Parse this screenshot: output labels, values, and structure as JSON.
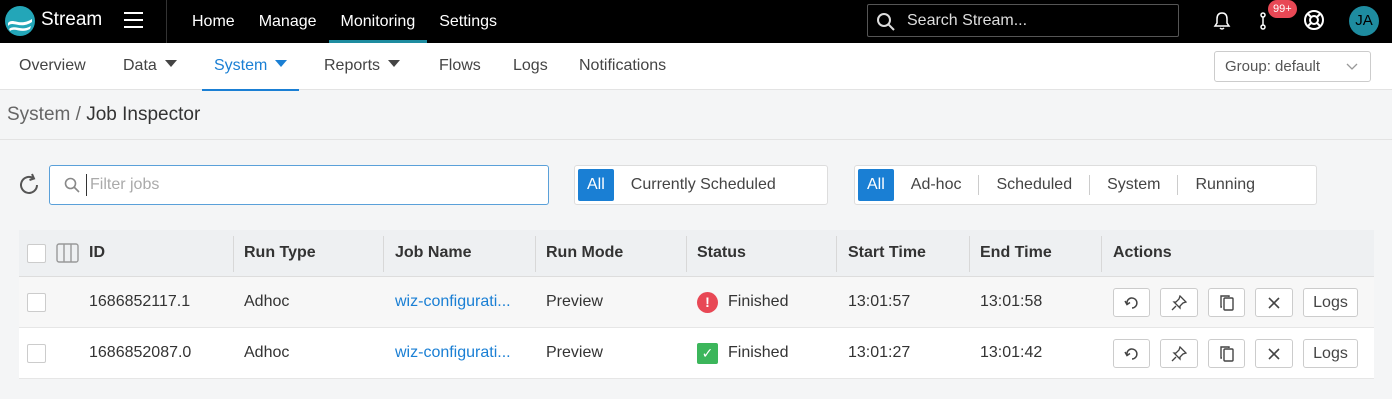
{
  "app": {
    "name": "Stream"
  },
  "topnav": {
    "items": [
      "Home",
      "Manage",
      "Monitoring",
      "Settings"
    ],
    "active": "Monitoring"
  },
  "search": {
    "placeholder": "Search Stream..."
  },
  "notifications": {
    "badge": "99+"
  },
  "user": {
    "initials": "JA"
  },
  "subnav": {
    "overview": "Overview",
    "data": "Data",
    "system": "System",
    "reports": "Reports",
    "flows": "Flows",
    "logs": "Logs",
    "notifications": "Notifications",
    "group": "Group: default"
  },
  "breadcrumb": {
    "parent": "System",
    "separator": " / ",
    "current": "Job Inspector"
  },
  "filter": {
    "placeholder": "Filter jobs"
  },
  "scope_seg": {
    "all": "All",
    "scheduled": "Currently Scheduled"
  },
  "type_seg": {
    "all": "All",
    "adhoc": "Ad-hoc",
    "scheduled": "Scheduled",
    "system": "System",
    "running": "Running"
  },
  "table": {
    "headers": {
      "id": "ID",
      "run_type": "Run Type",
      "job_name": "Job Name",
      "run_mode": "Run Mode",
      "status": "Status",
      "start": "Start Time",
      "end": "End Time",
      "actions": "Actions"
    },
    "rows": [
      {
        "id": "1686852117.1",
        "run_type": "Adhoc",
        "job_name": "wiz-configurati...",
        "run_mode": "Preview",
        "status": "Finished",
        "status_icon": "error-icon",
        "start": "13:01:57",
        "end": "13:01:58",
        "logs": "Logs"
      },
      {
        "id": "1686852087.0",
        "run_type": "Adhoc",
        "job_name": "wiz-configurati...",
        "run_mode": "Preview",
        "status": "Finished",
        "status_icon": "success-icon",
        "start": "13:01:27",
        "end": "13:01:42",
        "logs": "Logs"
      }
    ]
  },
  "colors": {
    "accent": "#1a7fd4",
    "brand": "#23a6b8",
    "error": "#e84855",
    "success": "#3cb65b"
  }
}
